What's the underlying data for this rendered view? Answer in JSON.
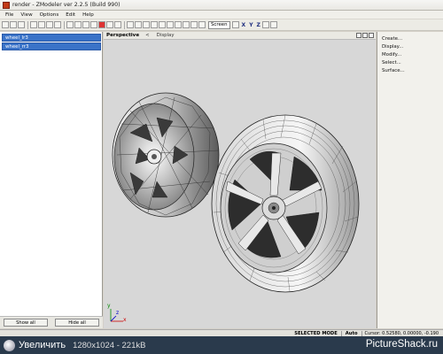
{
  "window": {
    "title": "render - ZModeler ver 2.2.5 (Build 990)"
  },
  "menu": [
    "File",
    "View",
    "Options",
    "Edit",
    "Help"
  ],
  "toolbar": {
    "view_select": "Screen",
    "axis_x": "X",
    "axis_y": "Y",
    "axis_z": "Z"
  },
  "objects": [
    "wheel_lr3",
    "wheel_rr3"
  ],
  "left_footer": {
    "show_all": "Show all",
    "hide_all": "Hide all"
  },
  "viewport": {
    "tab": "Perspective",
    "menu_sep": "<",
    "menu_display": "Display",
    "axis_labels": {
      "x": "x",
      "y": "y",
      "z": "z"
    }
  },
  "commands": [
    "Create...",
    "Display...",
    "Modify...",
    "Select...",
    "Surface..."
  ],
  "status": {
    "mode": "SELECTED MODE",
    "auto": "Auto",
    "cursor": "Cursor: 0.52580, 0.00000, -0.190"
  },
  "overlay": {
    "zoom_text": "Увеличить",
    "resolution": "1280x1024 - 221kB",
    "brand": "PictureShack.ru"
  },
  "colors": {
    "selection": "#3a73c8",
    "viewport_bg": "#d7d7d7",
    "overlay_bg": "#2a3a4c"
  },
  "icons": {
    "app": "zmodeler-app-icon",
    "overlay": "magnifier-icon"
  }
}
